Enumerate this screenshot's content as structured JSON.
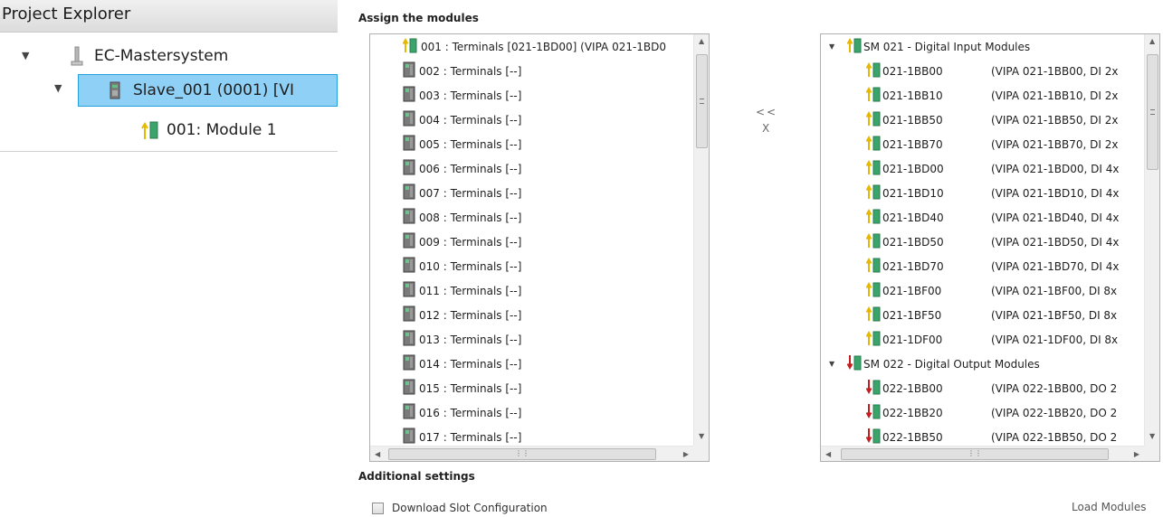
{
  "project_explorer": {
    "title": "Project Explorer",
    "tree": [
      {
        "label": "EC-Mastersystem",
        "icon": "mastersystem-icon"
      },
      {
        "label": "Slave_001 (0001) [VI",
        "icon": "slave-device-icon",
        "selected": true
      },
      {
        "label": "001: Module 1",
        "icon": "io-module-icon"
      }
    ]
  },
  "assign": {
    "title": "Assign the modules",
    "slots": [
      {
        "label": "001 : Terminals [021-1BD00] (VIPA 021-1BD0",
        "assigned": true
      },
      {
        "label": "002 : Terminals [--]",
        "assigned": false
      },
      {
        "label": "003 : Terminals [--]",
        "assigned": false
      },
      {
        "label": "004 : Terminals [--]",
        "assigned": false
      },
      {
        "label": "005 : Terminals [--]",
        "assigned": false
      },
      {
        "label": "006 : Terminals [--]",
        "assigned": false
      },
      {
        "label": "007 : Terminals [--]",
        "assigned": false
      },
      {
        "label": "008 : Terminals [--]",
        "assigned": false
      },
      {
        "label": "009 : Terminals [--]",
        "assigned": false
      },
      {
        "label": "010 : Terminals [--]",
        "assigned": false
      },
      {
        "label": "011 : Terminals [--]",
        "assigned": false
      },
      {
        "label": "012 : Terminals [--]",
        "assigned": false
      },
      {
        "label": "013 : Terminals [--]",
        "assigned": false
      },
      {
        "label": "014 : Terminals [--]",
        "assigned": false
      },
      {
        "label": "015 : Terminals [--]",
        "assigned": false
      },
      {
        "label": "016 : Terminals [--]",
        "assigned": false
      },
      {
        "label": "017 : Terminals [--]",
        "assigned": false
      }
    ],
    "move_left_label": "<<",
    "remove_label": "X",
    "catalog": [
      {
        "type": "group",
        "kind": "input",
        "label": "SM 021 - Digital Input Modules"
      },
      {
        "type": "item",
        "kind": "input",
        "name": "021-1BB00",
        "desc": "(VIPA 021-1BB00, DI 2x"
      },
      {
        "type": "item",
        "kind": "input",
        "name": "021-1BB10",
        "desc": "(VIPA 021-1BB10, DI 2x"
      },
      {
        "type": "item",
        "kind": "input",
        "name": "021-1BB50",
        "desc": "(VIPA 021-1BB50, DI 2x"
      },
      {
        "type": "item",
        "kind": "input",
        "name": "021-1BB70",
        "desc": "(VIPA 021-1BB70, DI 2x"
      },
      {
        "type": "item",
        "kind": "input",
        "name": "021-1BD00",
        "desc": "(VIPA 021-1BD00, DI 4x"
      },
      {
        "type": "item",
        "kind": "input",
        "name": "021-1BD10",
        "desc": "(VIPA 021-1BD10, DI 4x"
      },
      {
        "type": "item",
        "kind": "input",
        "name": "021-1BD40",
        "desc": "(VIPA 021-1BD40, DI 4x"
      },
      {
        "type": "item",
        "kind": "input",
        "name": "021-1BD50",
        "desc": "(VIPA 021-1BD50, DI 4x"
      },
      {
        "type": "item",
        "kind": "input",
        "name": "021-1BD70",
        "desc": "(VIPA 021-1BD70, DI 4x"
      },
      {
        "type": "item",
        "kind": "input",
        "name": "021-1BF00",
        "desc": "(VIPA 021-1BF00, DI 8x"
      },
      {
        "type": "item",
        "kind": "input",
        "name": "021-1BF50",
        "desc": "(VIPA 021-1BF50, DI 8x"
      },
      {
        "type": "item",
        "kind": "input",
        "name": "021-1DF00",
        "desc": "(VIPA 021-1DF00, DI 8x"
      },
      {
        "type": "group",
        "kind": "output",
        "label": "SM 022 - Digital Output Modules"
      },
      {
        "type": "item",
        "kind": "output",
        "name": "022-1BB00",
        "desc": "(VIPA 022-1BB00, DO 2"
      },
      {
        "type": "item",
        "kind": "output",
        "name": "022-1BB20",
        "desc": "(VIPA 022-1BB20, DO 2"
      },
      {
        "type": "item",
        "kind": "output",
        "name": "022-1BB50",
        "desc": "(VIPA 022-1BB50, DO 2"
      }
    ]
  },
  "additional": {
    "title": "Additional settings",
    "download_slot_label": "Download Slot Configuration",
    "download_slot_checked": false,
    "load_modules_label": "Load Modules"
  },
  "colors": {
    "selection_fill": "#8fd1f6",
    "selection_border": "#26a0da",
    "input_arrow": "#e6b800",
    "output_arrow": "#c41e1e",
    "module_green": "#3aa56a"
  }
}
